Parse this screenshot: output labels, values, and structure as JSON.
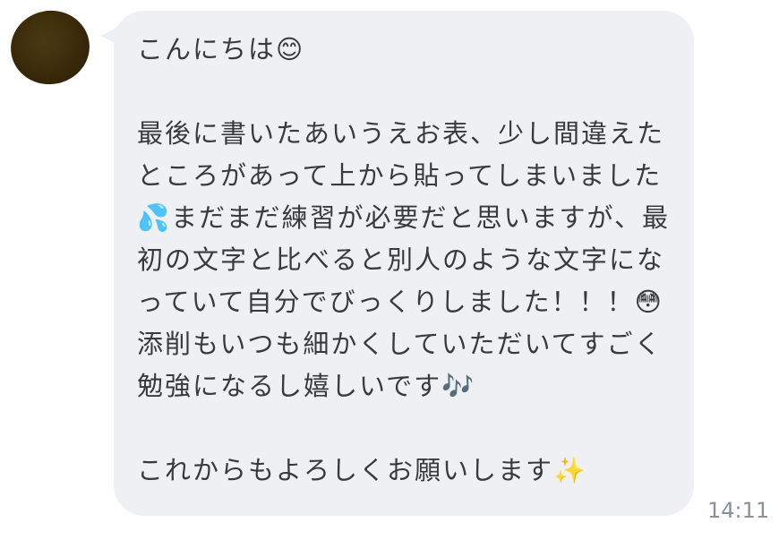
{
  "message": {
    "text": "こんにちは😊\n\n最後に書いたあいうえお表、少し間違えたところがあって上から貼ってしまいました💦まだまだ練習が必要だと思いますが、最初の文字と比べると別人のような文字になっていて自分でびっくりしました！！！😳\n添削もいつも細かくしていただいてすごく勉強になるし嬉しいです🎶\n\nこれからもよろしくお願いします✨",
    "timestamp": "14:11"
  },
  "avatar": {
    "color": "#3a2a0a"
  },
  "colors": {
    "bubble": "#eef0f4",
    "text": "#3a3a3a",
    "timestamp": "#8a8f98"
  }
}
